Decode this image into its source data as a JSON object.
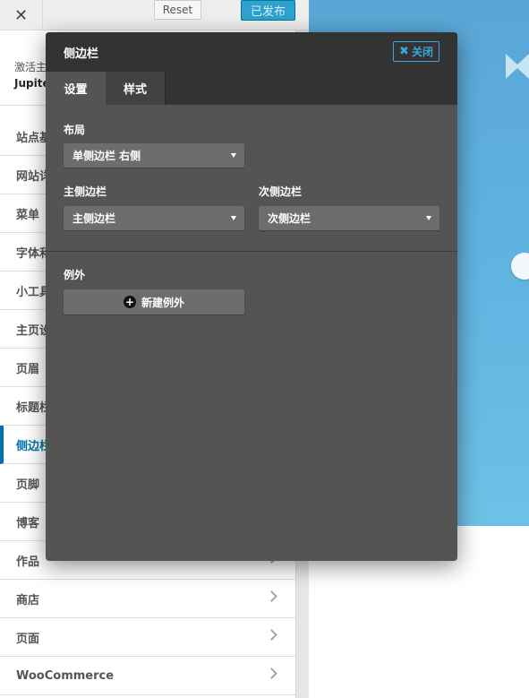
{
  "topbar": {
    "close_label": "✕",
    "reset_label": "Reset",
    "publish_label": "已发布"
  },
  "theme_info": {
    "active_label": "激活主",
    "theme_name": "Jupite"
  },
  "menu": {
    "items": [
      {
        "label": "站点基",
        "active": false
      },
      {
        "label": "网站详",
        "active": false
      },
      {
        "label": "菜单",
        "active": false
      },
      {
        "label": "字体和",
        "active": false
      },
      {
        "label": "小工具",
        "active": false
      },
      {
        "label": "主页设",
        "active": false
      },
      {
        "label": "页眉",
        "active": false
      },
      {
        "label": "标题栏",
        "active": false
      },
      {
        "label": "侧边栏",
        "active": true
      },
      {
        "label": "页脚",
        "active": false
      },
      {
        "label": "博客",
        "active": false
      },
      {
        "label": "作品",
        "active": false
      },
      {
        "label": "商店",
        "active": false
      },
      {
        "label": "页面",
        "active": false
      },
      {
        "label": "WooCommerce",
        "active": false
      }
    ]
  },
  "dialog": {
    "title": "侧边栏",
    "close_label": "关闭",
    "tabs": {
      "settings": "设置",
      "style": "样式"
    },
    "layout": {
      "label": "布局",
      "value": "单侧边栏 右侧"
    },
    "main_sidebar": {
      "label": "主侧边栏",
      "value": "主侧边栏"
    },
    "secondary_sidebar": {
      "label": "次侧边栏",
      "value": "次侧边栏"
    },
    "exceptions": {
      "label": "例外",
      "add_label": "新建例外"
    }
  },
  "colors": {
    "accent": "#0073aa",
    "publish": "#2ea2cc",
    "dialog_bg": "#545454",
    "dialog_header": "#333333",
    "close_accent": "#3aa5e0"
  }
}
